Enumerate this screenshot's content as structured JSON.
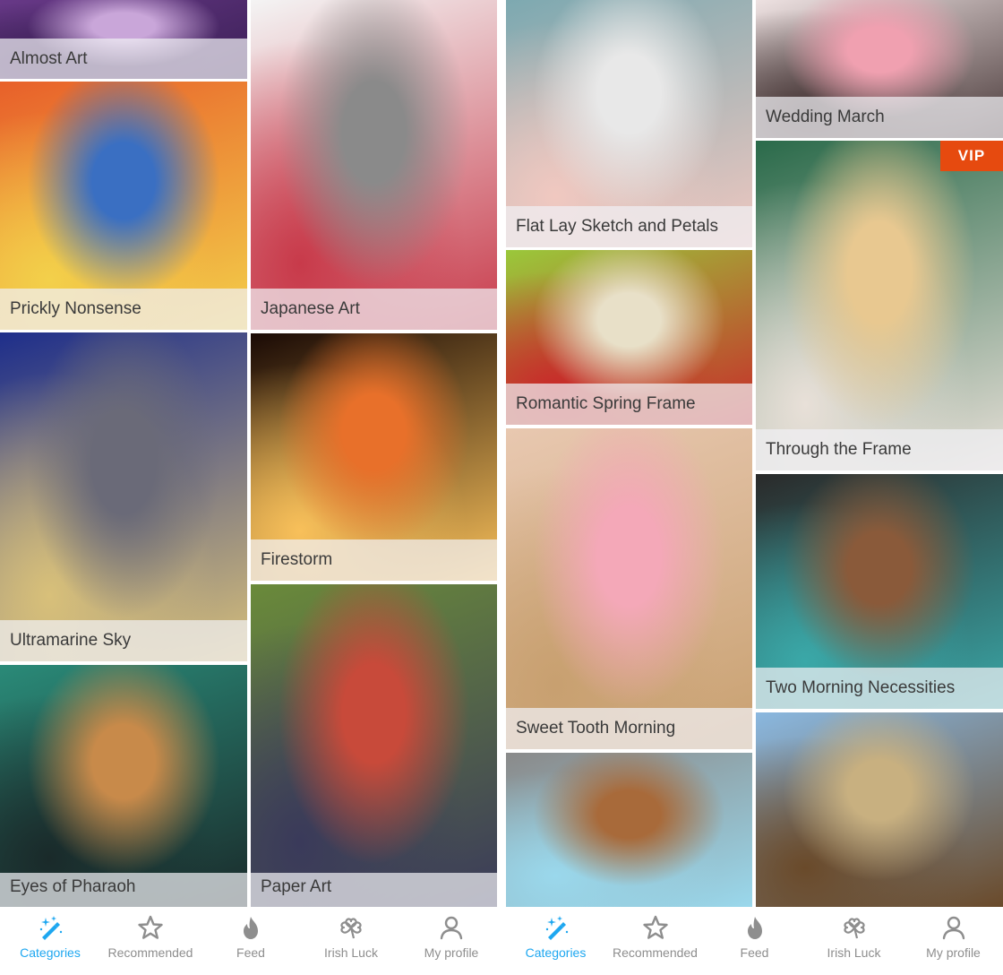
{
  "left_screen": {
    "columns": [
      [
        {
          "title": "Almost Art",
          "vip": false,
          "palette": [
            "#6a3a8a",
            "#c9a6d9",
            "#3a1f55"
          ]
        },
        {
          "title": "Prickly Nonsense",
          "vip": false,
          "palette": [
            "#e8602a",
            "#3a6fc2",
            "#f3d04a"
          ]
        },
        {
          "title": "Ultramarine Sky",
          "vip": false,
          "palette": [
            "#1e2e8a",
            "#6a6a78",
            "#d8c07a"
          ]
        },
        {
          "title": "Eyes of Pharaoh",
          "vip": false,
          "palette": [
            "#2a8a78",
            "#c88a4a",
            "#1a2a2a"
          ]
        }
      ],
      [
        {
          "title": "Japanese Art",
          "vip": false,
          "palette": [
            "#f4f4f4",
            "#8a8a8a",
            "#c83a4a"
          ]
        },
        {
          "title": "Firestorm",
          "vip": false,
          "palette": [
            "#1a0a05",
            "#e8702a",
            "#f8c05a"
          ]
        },
        {
          "title": "Paper Art",
          "vip": false,
          "palette": [
            "#6a8a3a",
            "#c84a3a",
            "#3a3a5a"
          ]
        }
      ]
    ]
  },
  "right_screen": {
    "columns": [
      [
        {
          "title": "Flat Lay Sketch and Petals",
          "vip": false,
          "palette": [
            "#7aa8b0",
            "#e8e8e8",
            "#f0c8c0"
          ]
        },
        {
          "title": "Romantic Spring Frame",
          "vip": false,
          "palette": [
            "#9ac83a",
            "#e8e0c8",
            "#c82a2a"
          ]
        },
        {
          "title": "Sweet Tooth Morning",
          "vip": false,
          "palette": [
            "#e8c8b0",
            "#f4a8b8",
            "#c8a070"
          ]
        },
        {
          "title": "",
          "vip": false,
          "palette": [
            "#8a8a8a",
            "#a86a3a",
            "#9ad8ec"
          ]
        }
      ],
      [
        {
          "title": "Wedding March",
          "vip": false,
          "palette": [
            "#f4e8e8",
            "#f0a0b0",
            "#4a3a3a"
          ]
        },
        {
          "title": "Through the Frame",
          "vip": true,
          "palette": [
            "#2a6a4a",
            "#e8c890",
            "#e8e0d8"
          ]
        },
        {
          "title": "Two Morning Necessities",
          "vip": false,
          "palette": [
            "#2a2a2a",
            "#8a5a3a",
            "#3aa8a8"
          ]
        },
        {
          "title": "",
          "vip": false,
          "palette": [
            "#8ab8e0",
            "#c8b080",
            "#6a4a2a"
          ]
        }
      ]
    ]
  },
  "vip_label": "VIP",
  "tabbar": {
    "active_color": "#1ea7f0",
    "inactive_color": "#8e8e8e",
    "items": [
      {
        "label": "Categories",
        "icon": "magic-wand-icon",
        "active": true
      },
      {
        "label": "Recommended",
        "icon": "star-icon",
        "active": false
      },
      {
        "label": "Feed",
        "icon": "flame-icon",
        "active": false
      },
      {
        "label": "Irish Luck",
        "icon": "shamrock-icon",
        "active": false
      },
      {
        "label": "My profile",
        "icon": "person-icon",
        "active": false
      }
    ]
  }
}
